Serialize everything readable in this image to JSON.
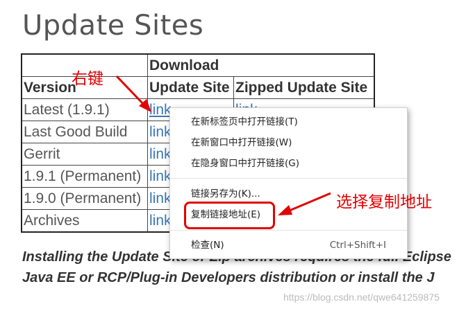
{
  "page": {
    "title": "Update Sites",
    "paragraph_line1": "Installing the Update Site or Zip archives requires the full Eclipse",
    "paragraph_line2": "Java EE or RCP/Plug-in Developers distribution or install the J"
  },
  "table": {
    "group_header": "Download",
    "headers": [
      "Version",
      "Update Site",
      "Zipped Update Site"
    ],
    "rows": [
      {
        "version": "Latest (1.9.1)",
        "update_site": "link",
        "zipped": "link"
      },
      {
        "version": "Last Good Build",
        "update_site": "link",
        "zipped": ""
      },
      {
        "version": "Gerrit",
        "update_site": "link",
        "zipped": ""
      },
      {
        "version": "1.9.1 (Permanent)",
        "update_site": "link",
        "zipped": ""
      },
      {
        "version": "1.9.0 (Permanent)",
        "update_site": "link",
        "zipped": ""
      },
      {
        "version": "Archives",
        "update_site": "link",
        "zipped": ""
      }
    ]
  },
  "context_menu": {
    "items": [
      {
        "label": "在新标签页中打开链接(T)",
        "shortcut": ""
      },
      {
        "label": "在新窗口中打开链接(W)",
        "shortcut": ""
      },
      {
        "label": "在隐身窗口中打开链接(G)",
        "shortcut": ""
      },
      {
        "label": "链接另存为(K)...",
        "shortcut": ""
      },
      {
        "label": "复制链接地址(E)",
        "shortcut": ""
      },
      {
        "label": "检查(N)",
        "shortcut": "Ctrl+Shift+I"
      }
    ]
  },
  "annotations": {
    "right_click": "右键",
    "choose_copy": "选择复制地址",
    "color": "#e30000"
  },
  "watermark": "https://blog.csdn.net/qwe641259875",
  "colors": {
    "link": "#3a77b5",
    "annotation": "#e30000"
  }
}
